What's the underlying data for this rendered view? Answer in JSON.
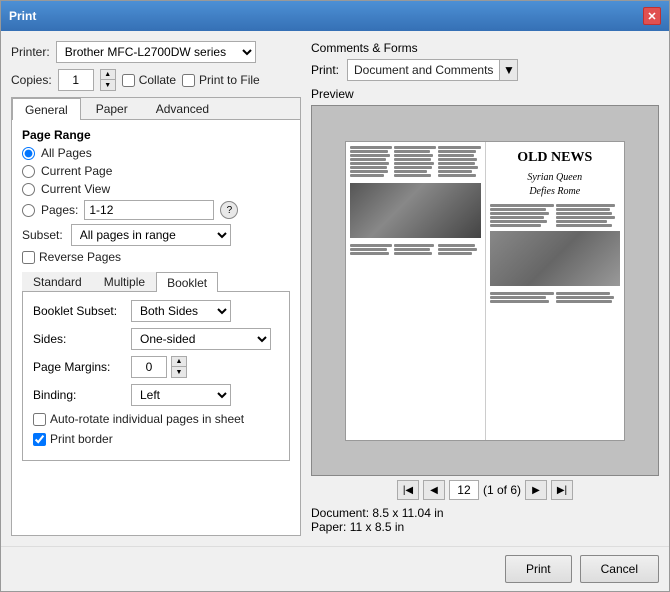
{
  "titleBar": {
    "title": "Print",
    "closeLabel": "✕"
  },
  "printer": {
    "label": "Printer:",
    "value": "Brother MFC-L2700DW series"
  },
  "copies": {
    "label": "Copies:",
    "value": "1"
  },
  "collate": {
    "label": "Collate",
    "checked": false
  },
  "printToFile": {
    "label": "Print to File",
    "checked": false
  },
  "tabs": {
    "general": "General",
    "paper": "Paper",
    "advanced": "Advanced",
    "activeTab": "general"
  },
  "pageRange": {
    "label": "Page Range",
    "allPages": "All Pages",
    "currentPage": "Current Page",
    "currentView": "Current View",
    "pages": "Pages:",
    "pagesValue": "1-12",
    "helpLabel": "?",
    "subset": "Subset:",
    "subsetValue": "All pages in range",
    "reversePages": "Reverse Pages"
  },
  "subTabs": {
    "standard": "Standard",
    "multiple": "Multiple",
    "booklet": "Booklet",
    "activeTab": "booklet"
  },
  "booklet": {
    "subsetLabel": "Booklet Subset:",
    "subsetValue": "Both Sides",
    "sidesLabel": "Sides:",
    "sidesValue": "One-sided",
    "marginsLabel": "Page Margins:",
    "marginsValue": "0",
    "bindingLabel": "Binding:",
    "bindingValue": "Left",
    "autoRotate": "Auto-rotate individual pages in sheet",
    "printBorder": "Print border",
    "autoRotateChecked": false,
    "printBorderChecked": true
  },
  "commentsAndForms": {
    "sectionLabel": "Comments & Forms",
    "printLabel": "Print:",
    "printValue": "Document and Comments"
  },
  "preview": {
    "label": "Preview",
    "headline": "OLD NEWS",
    "subheadline1": "Syrian Queen",
    "subheadline2": "Defies Rome",
    "pageNumber": "12",
    "pageOf": "(1 of 6)"
  },
  "docInfo": {
    "documentLabel": "Document:",
    "documentValue": "8.5 x 11.04 in",
    "paperLabel": "Paper:",
    "paperValue": "11 x 8.5 in"
  },
  "footer": {
    "printLabel": "Print",
    "cancelLabel": "Cancel"
  }
}
